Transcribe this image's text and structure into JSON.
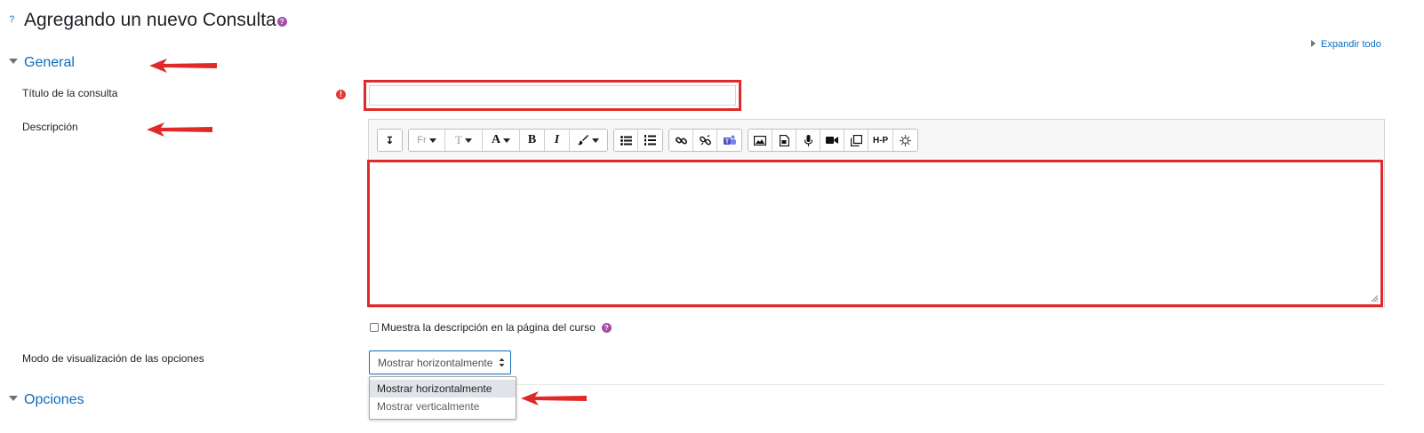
{
  "page": {
    "help_marker": "?",
    "title": "Agregando un nuevo Consulta",
    "title_info": "?",
    "expand_all": "Expandir todo"
  },
  "sections": {
    "general": "General",
    "opciones": "Opciones"
  },
  "fields": {
    "titulo": {
      "label": "Título de la consulta",
      "value": "",
      "required_icon": "!"
    },
    "descripcion": {
      "label": "Descripción"
    },
    "show_description": {
      "label": "Muestra la descripción en la página del curso",
      "checked": false,
      "info": "?"
    },
    "display_mode": {
      "label": "Modo de visualización de las opciones",
      "selected": "Mostrar horizontalmente",
      "options": [
        "Mostrar horizontalmente",
        "Mostrar verticalmente"
      ]
    }
  },
  "editor": {
    "toolbar": {
      "collapse": "↧",
      "font_family": "Fr",
      "font_size": "T",
      "font_color": "A",
      "bold": "B",
      "italic": "I",
      "h5p": "H-P"
    },
    "content": ""
  },
  "annotations": {
    "arrow_color": "#e02a2a",
    "box_color": "#e02a2a"
  },
  "icons": [
    "help-icon",
    "info-icon",
    "expand-all-icon",
    "collapse-icon",
    "required-icon",
    "font-family-icon",
    "font-size-icon",
    "font-color-icon",
    "bold-icon",
    "italic-icon",
    "paint-icon",
    "bullet-list-icon",
    "numbered-list-icon",
    "link-icon",
    "unlink-icon",
    "teams-icon",
    "image-icon",
    "media-icon",
    "microphone-icon",
    "video-camera-icon",
    "copy-icon",
    "h5p-icon",
    "accessibility-icon",
    "resize-handle-icon"
  ]
}
